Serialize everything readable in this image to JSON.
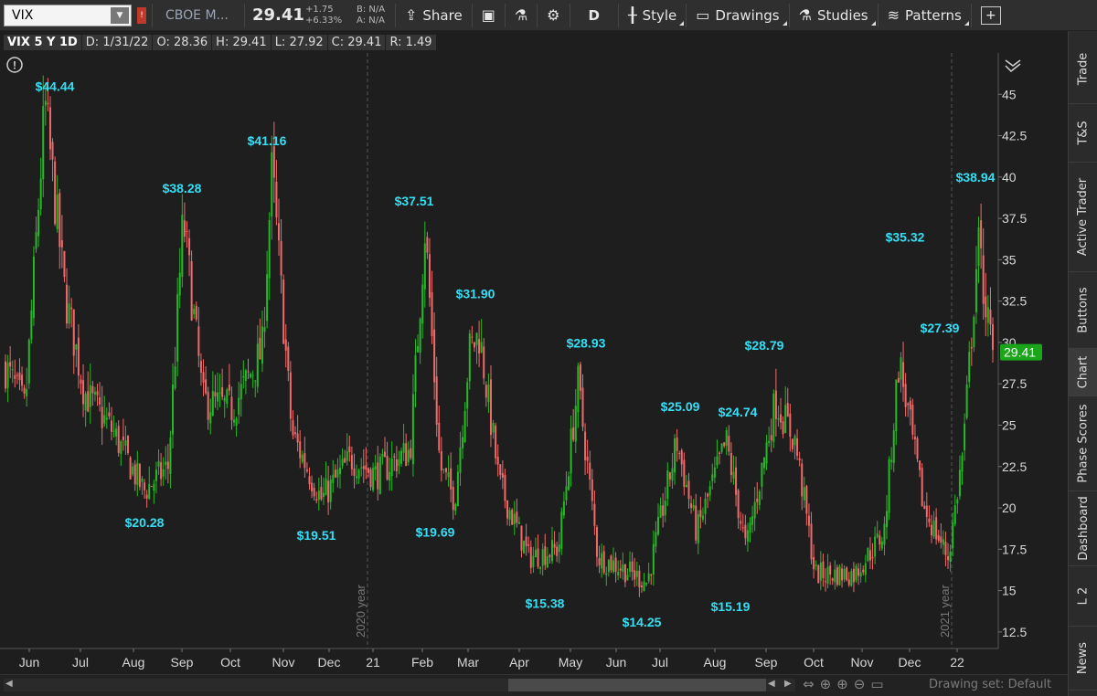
{
  "toolbar": {
    "symbol": "VIX",
    "exchange": "CBOE M...",
    "last": "29.41",
    "change": "+1.75",
    "change_pct": "+6.33%",
    "bid": "B: N/A",
    "ask": "A: N/A",
    "share": "Share",
    "period": "D",
    "style": "Style",
    "drawings": "Drawings",
    "studies": "Studies",
    "patterns": "Patterns"
  },
  "info": {
    "title": "VIX 5 Y 1D",
    "date": "D: 1/31/22",
    "open": "O: 28.36",
    "high": "H: 29.41",
    "low": "L: 27.92",
    "close": "C: 29.41",
    "range": "R: 1.49"
  },
  "sidebar": [
    "Trade",
    "T&S",
    "Active Trader",
    "Buttons",
    "Chart",
    "Phase Scores",
    "Dashboard",
    "L 2",
    "News"
  ],
  "scrollbar": {
    "drawing_set": "Drawing set: Default"
  },
  "colors": {
    "up": "#26b926",
    "down": "#f06a6a",
    "label": "#33dff5",
    "price_tag": "#1aa51a"
  },
  "chart_data": {
    "type": "candlestick",
    "title": "VIX 5 Y 1D",
    "ylim": [
      11.5,
      47.5
    ],
    "y_ticks": [
      "12.5",
      "15",
      "17.5",
      "20",
      "22.5",
      "25",
      "27.5",
      "30",
      "32.5",
      "35",
      "37.5",
      "40",
      "42.5",
      "45"
    ],
    "x_ticks": [
      "Jun",
      "Jul",
      "Aug",
      "Sep",
      "Oct",
      "Nov",
      "Dec",
      "21",
      "Feb",
      "Mar",
      "Apr",
      "May",
      "Jun",
      "Jul",
      "Aug",
      "Sep",
      "Oct",
      "Nov",
      "Dec",
      "22"
    ],
    "year_markers": [
      "2020 year",
      "2021 year"
    ],
    "current_price": "29.41",
    "annotations": [
      {
        "label": "$44.44",
        "value": 44.44,
        "kind": "high"
      },
      {
        "label": "$20.28",
        "value": 20.28,
        "kind": "low"
      },
      {
        "label": "$38.28",
        "value": 38.28,
        "kind": "high"
      },
      {
        "label": "$41.16",
        "value": 41.16,
        "kind": "high"
      },
      {
        "label": "$19.51",
        "value": 19.51,
        "kind": "low"
      },
      {
        "label": "$37.51",
        "value": 37.51,
        "kind": "high"
      },
      {
        "label": "$19.69",
        "value": 19.69,
        "kind": "low"
      },
      {
        "label": "$31.90",
        "value": 31.9,
        "kind": "high"
      },
      {
        "label": "$15.38",
        "value": 15.38,
        "kind": "low"
      },
      {
        "label": "$28.93",
        "value": 28.93,
        "kind": "high"
      },
      {
        "label": "$14.25",
        "value": 14.25,
        "kind": "low"
      },
      {
        "label": "$25.09",
        "value": 25.09,
        "kind": "high"
      },
      {
        "label": "$24.74",
        "value": 24.74,
        "kind": "high"
      },
      {
        "label": "$15.19",
        "value": 15.19,
        "kind": "low"
      },
      {
        "label": "$28.79",
        "value": 28.79,
        "kind": "high"
      },
      {
        "label": "$35.32",
        "value": 35.32,
        "kind": "high"
      },
      {
        "label": "$27.39",
        "value": 27.39,
        "kind": "low"
      },
      {
        "label": "$38.94",
        "value": 38.94,
        "kind": "high"
      }
    ],
    "path": [
      [
        0,
        28.5
      ],
      [
        0.02,
        26.0
      ],
      [
        0.04,
        44.4
      ],
      [
        0.06,
        33.0
      ],
      [
        0.08,
        27.0
      ],
      [
        0.11,
        24.5
      ],
      [
        0.14,
        21.0
      ],
      [
        0.165,
        22.5
      ],
      [
        0.18,
        37.5
      ],
      [
        0.2,
        26.5
      ],
      [
        0.23,
        26.0
      ],
      [
        0.26,
        29.5
      ],
      [
        0.27,
        40.5
      ],
      [
        0.29,
        24.5
      ],
      [
        0.32,
        20.5
      ],
      [
        0.35,
        23.0
      ],
      [
        0.375,
        22.0
      ],
      [
        0.41,
        23.5
      ],
      [
        0.425,
        37.0
      ],
      [
        0.44,
        22.5
      ],
      [
        0.455,
        20.5
      ],
      [
        0.47,
        29.5
      ],
      [
        0.48,
        30.5
      ],
      [
        0.5,
        21.5
      ],
      [
        0.53,
        17.0
      ],
      [
        0.56,
        17.5
      ],
      [
        0.58,
        27.5
      ],
      [
        0.6,
        17.0
      ],
      [
        0.62,
        16.5
      ],
      [
        0.65,
        15.5
      ],
      [
        0.68,
        24.0
      ],
      [
        0.7,
        18.5
      ],
      [
        0.73,
        24.0
      ],
      [
        0.75,
        17.5
      ],
      [
        0.78,
        26.5
      ],
      [
        0.8,
        24.0
      ],
      [
        0.82,
        16.0
      ],
      [
        0.86,
        16.0
      ],
      [
        0.89,
        18.5
      ],
      [
        0.905,
        29.0
      ],
      [
        0.93,
        20.0
      ],
      [
        0.955,
        17.0
      ],
      [
        0.97,
        23.5
      ],
      [
        0.985,
        36.0
      ],
      [
        1.0,
        29.0
      ]
    ]
  }
}
